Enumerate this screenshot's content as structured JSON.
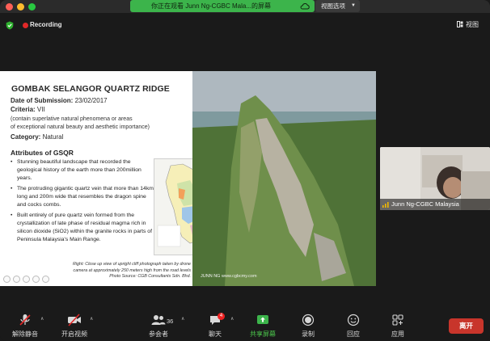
{
  "titlebar": {
    "share_banner": "你正在观看 Junn Ng-CGBC Mala...的屏幕",
    "view_options": "视图选项"
  },
  "topbar": {
    "recording_label": "Recording",
    "view_label": "视图"
  },
  "slide": {
    "title": "GOMBAK SELANGOR QUARTZ RIDGE",
    "date_label": "Date of Submission:",
    "date_value": " 23/02/2017",
    "criteria_label": "Criteria:",
    "criteria_value": " VII",
    "criteria_note_1": "(contain superlative natural phenomena or areas",
    "criteria_note_2": "of exceptional natural beauty and aesthetic importance)",
    "category_label": "Category:",
    "category_value": " Natural",
    "attributes_title": "Attributes of GSQR",
    "bullets": [
      "Stunning beautiful landscape that recorded the geological history of the earth more than 200million years.",
      "The protruding gigantic quartz vein that more than 14km long and 200m wide that resembles the dragon spine and cocks combs.",
      "Built entirely of pure quartz vein formed from the crystallization of late phase of residual magma rich in silicon dioxide (SiO2) within the granite rocks in parts of  Peninsula Malaysia's Main Range."
    ],
    "caption_1": "Right: Close up view of upright cliff photograph taken by drone",
    "caption_2": "camera at approximately 250 meters high from the road levels",
    "caption_3": "Photo Source: CGB Consultants Sdn. Bhd.",
    "photo_credit": "JUNN NG   www.cgbcmy.com"
  },
  "participant": {
    "name": "Junn Ng-CGBC Malaysia"
  },
  "toolbar": {
    "unmute": "解除静音",
    "start_video": "开启视频",
    "participants": "参会者",
    "participants_count": "36",
    "chat": "聊天",
    "chat_badge": "4",
    "share_screen": "共享屏幕",
    "record": "录制",
    "reactions": "回应",
    "apps": "应用",
    "end": "离开"
  },
  "colors": {
    "accent_green": "#3cb44b",
    "end_red": "#c8352b",
    "record_red": "#e02828"
  }
}
